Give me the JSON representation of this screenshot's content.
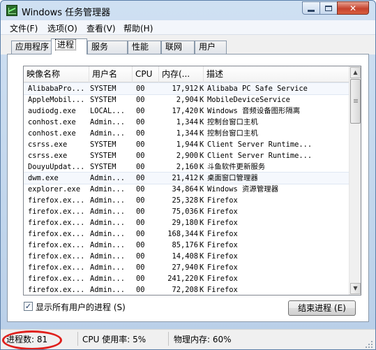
{
  "title": "Windows 任务管理器",
  "window_buttons": {
    "close": "✕"
  },
  "menu": [
    "文件(F)",
    "选项(O)",
    "查看(V)",
    "帮助(H)"
  ],
  "tabs": [
    "应用程序",
    "进程",
    "服务",
    "性能",
    "联网",
    "用户"
  ],
  "active_tab": "进程",
  "columns": [
    "映像名称",
    "用户名",
    "CPU",
    "内存(...",
    "描述"
  ],
  "mem_unit": "K",
  "processes": [
    {
      "name": "AlibabaPro...",
      "user": "SYSTEM",
      "cpu": "00",
      "mem": "17,912",
      "desc": "Alibaba PC Safe Service"
    },
    {
      "name": "AppleMobil...",
      "user": "SYSTEM",
      "cpu": "00",
      "mem": "2,904",
      "desc": "MobileDeviceService"
    },
    {
      "name": "audiodg.exe",
      "user": "LOCAL...",
      "cpu": "00",
      "mem": "17,420",
      "desc": "Windows 音频设备图形隔离"
    },
    {
      "name": "conhost.exe",
      "user": "Admin...",
      "cpu": "00",
      "mem": "1,344",
      "desc": "控制台窗口主机"
    },
    {
      "name": "conhost.exe",
      "user": "Admin...",
      "cpu": "00",
      "mem": "1,344",
      "desc": "控制台窗口主机"
    },
    {
      "name": "csrss.exe",
      "user": "SYSTEM",
      "cpu": "00",
      "mem": "1,944",
      "desc": "Client Server Runtime..."
    },
    {
      "name": "csrss.exe",
      "user": "SYSTEM",
      "cpu": "00",
      "mem": "2,900",
      "desc": "Client Server Runtime..."
    },
    {
      "name": "DouyuUpdat...",
      "user": "SYSTEM",
      "cpu": "00",
      "mem": "2,160",
      "desc": "斗鱼软件更新服务"
    },
    {
      "name": "dwm.exe",
      "user": "Admin...",
      "cpu": "00",
      "mem": "21,412",
      "desc": "桌面窗口管理器"
    },
    {
      "name": "explorer.exe",
      "user": "Admin...",
      "cpu": "00",
      "mem": "34,864",
      "desc": "Windows 资源管理器"
    },
    {
      "name": "firefox.ex...",
      "user": "Admin...",
      "cpu": "00",
      "mem": "25,328",
      "desc": "Firefox"
    },
    {
      "name": "firefox.ex...",
      "user": "Admin...",
      "cpu": "00",
      "mem": "75,036",
      "desc": "Firefox"
    },
    {
      "name": "firefox.ex...",
      "user": "Admin...",
      "cpu": "00",
      "mem": "29,180",
      "desc": "Firefox"
    },
    {
      "name": "firefox.ex...",
      "user": "Admin...",
      "cpu": "00",
      "mem": "168,344",
      "desc": "Firefox"
    },
    {
      "name": "firefox.ex...",
      "user": "Admin...",
      "cpu": "00",
      "mem": "85,176",
      "desc": "Firefox"
    },
    {
      "name": "firefox.ex...",
      "user": "Admin...",
      "cpu": "00",
      "mem": "14,408",
      "desc": "Firefox"
    },
    {
      "name": "firefox.ex...",
      "user": "Admin...",
      "cpu": "00",
      "mem": "27,940",
      "desc": "Firefox"
    },
    {
      "name": "firefox.ex...",
      "user": "Admin...",
      "cpu": "00",
      "mem": "241,220",
      "desc": "Firefox"
    },
    {
      "name": "firefox.ex...",
      "user": "Admin...",
      "cpu": "00",
      "mem": "72,208",
      "desc": "Firefox"
    }
  ],
  "highlighted_rows": [
    0,
    8
  ],
  "show_all_users": {
    "label": "显示所有用户的进程 (S)",
    "checked": true,
    "check_glyph": "✓"
  },
  "end_process_button": "结束进程 (E)",
  "status": {
    "processes": "进程数: 81",
    "cpu": "CPU 使用率: 5%",
    "memory": "物理内存: 60%"
  },
  "scroll_arrows": {
    "up": "▲",
    "down": "▼"
  },
  "colors": {
    "annotation": "#e0201c",
    "close_button": "#c6432e"
  }
}
